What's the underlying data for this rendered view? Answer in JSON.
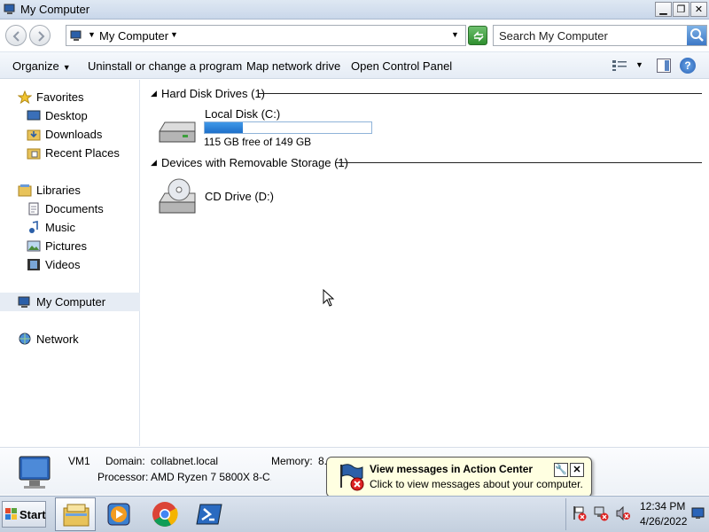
{
  "window": {
    "title": "My Computer"
  },
  "titlebar": {
    "minimize": "▁",
    "maximize": "❐",
    "close": "✕"
  },
  "address": {
    "location": "My Computer",
    "search_placeholder": "Search My Computer"
  },
  "commands": {
    "organize": "Organize",
    "uninstall": "Uninstall or change a program",
    "map_drive": "Map network drive",
    "control_panel": "Open Control Panel"
  },
  "navpane": {
    "favorites": "Favorites",
    "desktop": "Desktop",
    "downloads": "Downloads",
    "recent": "Recent Places",
    "libraries": "Libraries",
    "documents": "Documents",
    "music": "Music",
    "pictures": "Pictures",
    "videos": "Videos",
    "computer": "My Computer",
    "network": "Network"
  },
  "groups": {
    "hdd": {
      "label": "Hard Disk Drives (1)"
    },
    "removable": {
      "label": "Devices with Removable Storage (1)"
    }
  },
  "drives": {
    "c": {
      "name": "Local Disk (C:)",
      "free_text": "115 GB free of 149 GB",
      "used_fraction": 0.23
    },
    "d": {
      "name": "CD Drive (D:)"
    }
  },
  "details": {
    "name": "VM1",
    "domain_label": "Domain:",
    "domain_value": "collabnet.local",
    "memory_label": "Memory:",
    "memory_value": "8.",
    "processor_label": "Processor:",
    "processor_value": "AMD Ryzen 7 5800X 8-C..."
  },
  "balloon": {
    "title": "View messages in Action Center",
    "text": "Click to view messages about your computer.",
    "settings_glyph": "🔧",
    "close_glyph": "✕"
  },
  "taskbar": {
    "start_label": "Start",
    "apps": [
      "file-explorer-icon",
      "media-player-icon",
      "chrome-icon",
      "powershell-icon"
    ],
    "time": "12:34 PM",
    "date": "4/26/2022"
  },
  "colors": {
    "accent": "#1e6fc9",
    "balloon_bg": "#ffffe1",
    "taskbar": "#c3cfde"
  }
}
